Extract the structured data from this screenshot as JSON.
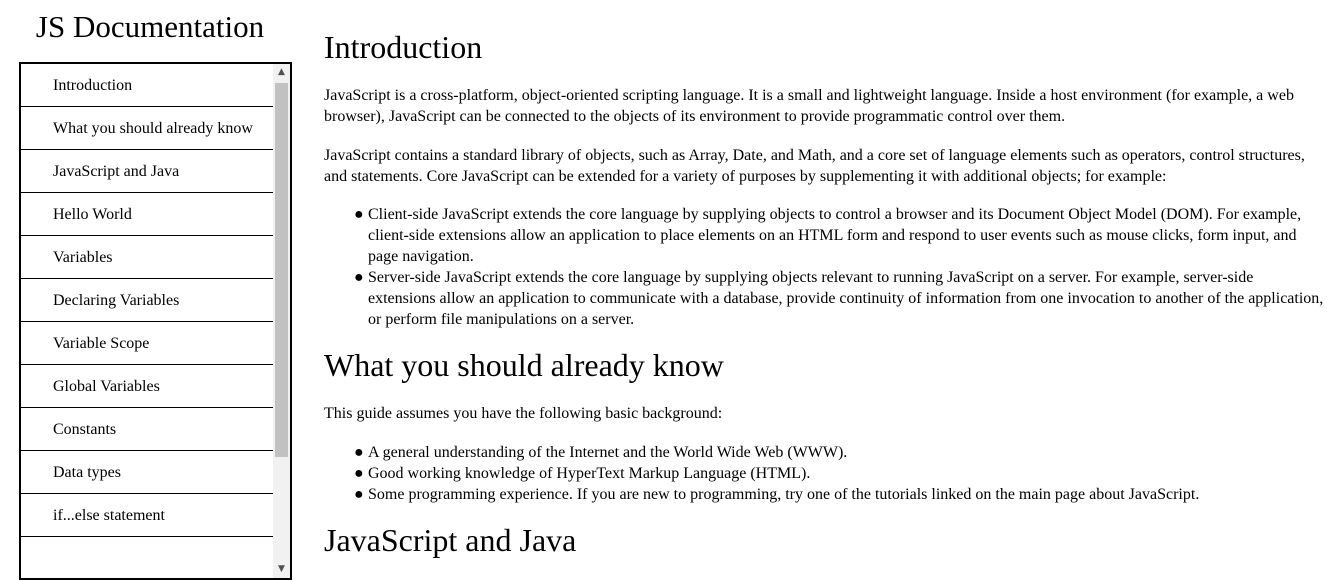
{
  "navbar": {
    "title": "JS Documentation",
    "items": [
      {
        "label": "Introduction"
      },
      {
        "label": "What you should already know"
      },
      {
        "label": "JavaScript and Java"
      },
      {
        "label": "Hello World"
      },
      {
        "label": "Variables"
      },
      {
        "label": "Declaring Variables"
      },
      {
        "label": "Variable Scope"
      },
      {
        "label": "Global Variables"
      },
      {
        "label": "Constants"
      },
      {
        "label": "Data types"
      },
      {
        "label": "if...else statement"
      }
    ]
  },
  "main": {
    "introduction": {
      "title": "Introduction",
      "p1": "JavaScript is a cross-platform, object-oriented scripting language. It is a small and lightweight language. Inside a host environment (for example, a web browser), JavaScript can be connected to the objects of its environment to provide programmatic control over them.",
      "p2": "JavaScript contains a standard library of objects, such as Array, Date, and Math, and a core set of language elements such as operators, control structures, and statements. Core JavaScript can be extended for a variety of purposes by supplementing it with additional objects; for example:",
      "bullets": [
        "Client-side JavaScript extends the core language by supplying objects to control a browser and its Document Object Model (DOM). For example, client-side extensions allow an application to place elements on an HTML form and respond to user events such as mouse clicks, form input, and page navigation.",
        "Server-side JavaScript extends the core language by supplying objects relevant to running JavaScript on a server. For example, server-side extensions allow an application to communicate with a database, provide continuity of information from one invocation to another of the application, or perform file manipulations on a server."
      ]
    },
    "know": {
      "title": "What you should already know",
      "p1": "This guide assumes you have the following basic background:",
      "bullets": [
        "A general understanding of the Internet and the World Wide Web (WWW).",
        "Good working knowledge of HyperText Markup Language (HTML).",
        "Some programming experience. If you are new to programming, try one of the tutorials linked on the main page about JavaScript."
      ]
    },
    "java": {
      "title": "JavaScript and Java"
    }
  }
}
